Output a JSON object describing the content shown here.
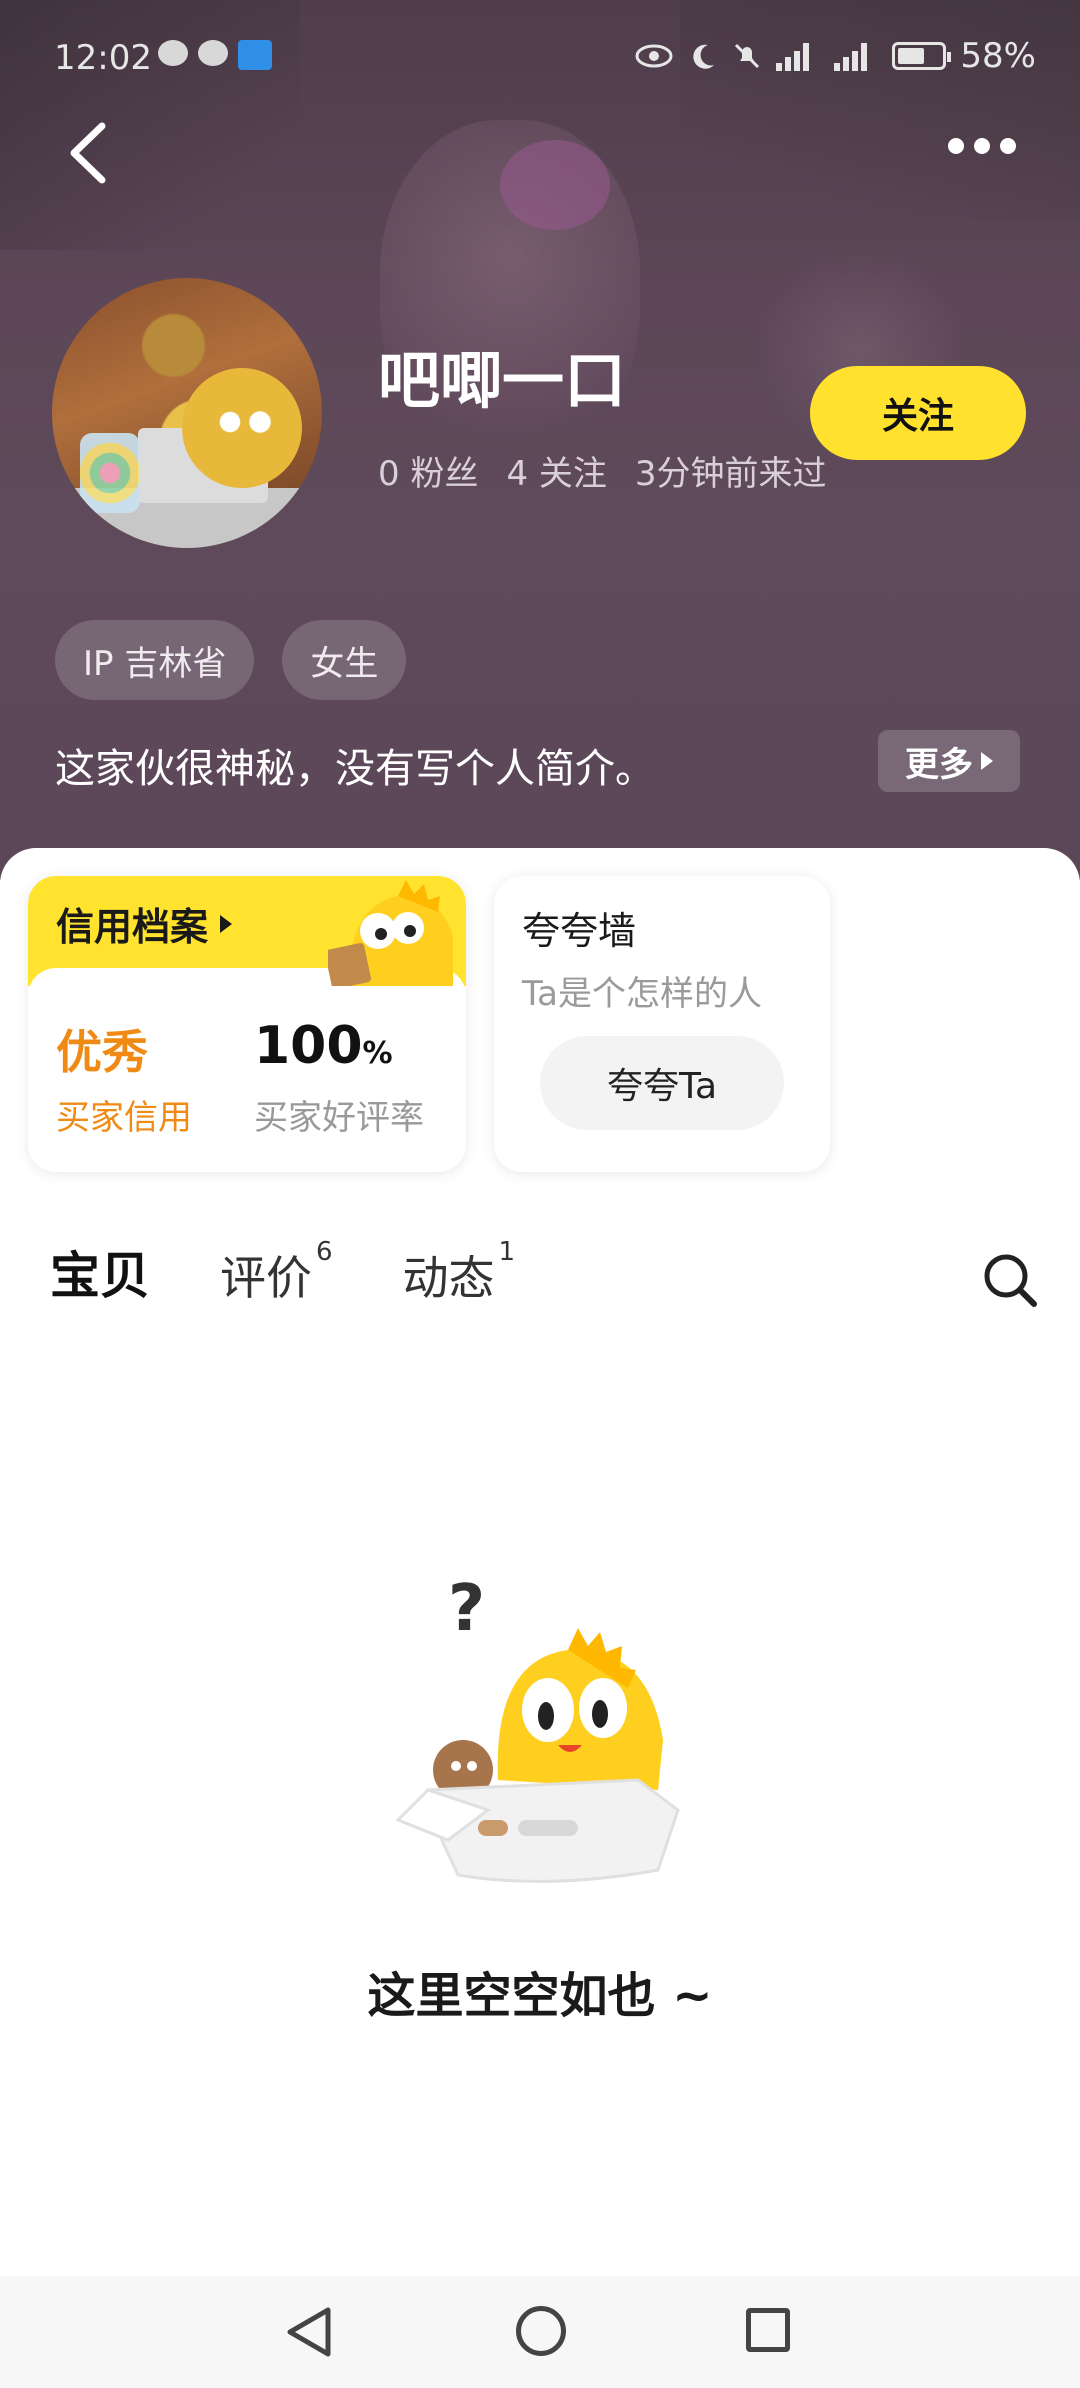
{
  "status": {
    "time": "12:02",
    "battery": "58%",
    "icons": [
      "wechat-icon",
      "wechat-icon",
      "flag-app-icon",
      "eye-icon",
      "moon-icon",
      "mute-icon",
      "signal-4g-icon",
      "signal-4g-icon",
      "battery-icon"
    ]
  },
  "profile": {
    "name": "吧唧一口",
    "fans": "0 粉丝",
    "following": "4 关注",
    "last_seen": "3分钟前来过",
    "follow_label": "关注",
    "tags": [
      "IP 吉林省",
      "女生"
    ],
    "bio": "这家伙很神秘，没有写个人简介。",
    "bio_more": "更多"
  },
  "credit_card": {
    "title": "信用档案",
    "rating_value": "优秀",
    "rating_label": "买家信用",
    "positive_value": "100",
    "positive_unit": "%",
    "positive_label": "买家好评率"
  },
  "praise_card": {
    "title": "夸夸墙",
    "subtitle": "Ta是个怎样的人",
    "button": "夸夸Ta"
  },
  "tabs": [
    {
      "label": "宝贝",
      "count": ""
    },
    {
      "label": "评价",
      "count": "6"
    },
    {
      "label": "动态",
      "count": "1"
    }
  ],
  "empty": {
    "message": "这里空空如也 ~"
  },
  "colors": {
    "accent": "#ffe12e",
    "credit_orange": "#ef8a14",
    "header_bg": "#5d4758"
  }
}
